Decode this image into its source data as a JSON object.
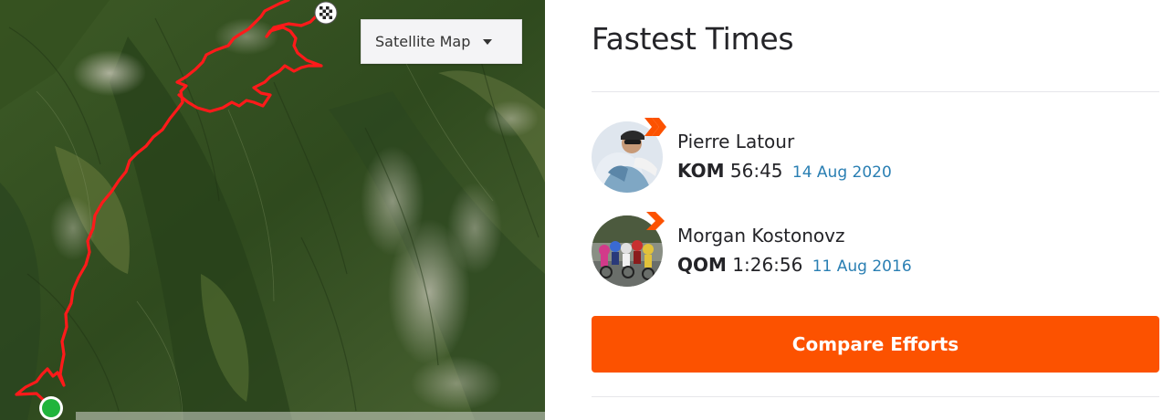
{
  "map": {
    "type_selector_label": "Satellite Map",
    "route_color": "#ff1a1a",
    "start_marker_color": "#20b43c",
    "finish_marker": "checkered-flag-icon"
  },
  "panel": {
    "title": "Fastest Times",
    "leaders": [
      {
        "name": "Pierre Latour",
        "crown": "KOM",
        "time": "56:45",
        "date": "14 Aug 2020",
        "badge_icon": "double-chevron-icon"
      },
      {
        "name": "Morgan Kostonovz",
        "crown": "QOM",
        "time": "1:26:56",
        "date": "11 Aug 2016",
        "badge_icon": "chevron-icon"
      }
    ],
    "compare_button_label": "Compare Efforts"
  },
  "colors": {
    "accent": "#fc5200",
    "date_link": "#2a7fb3",
    "text": "#242428"
  }
}
